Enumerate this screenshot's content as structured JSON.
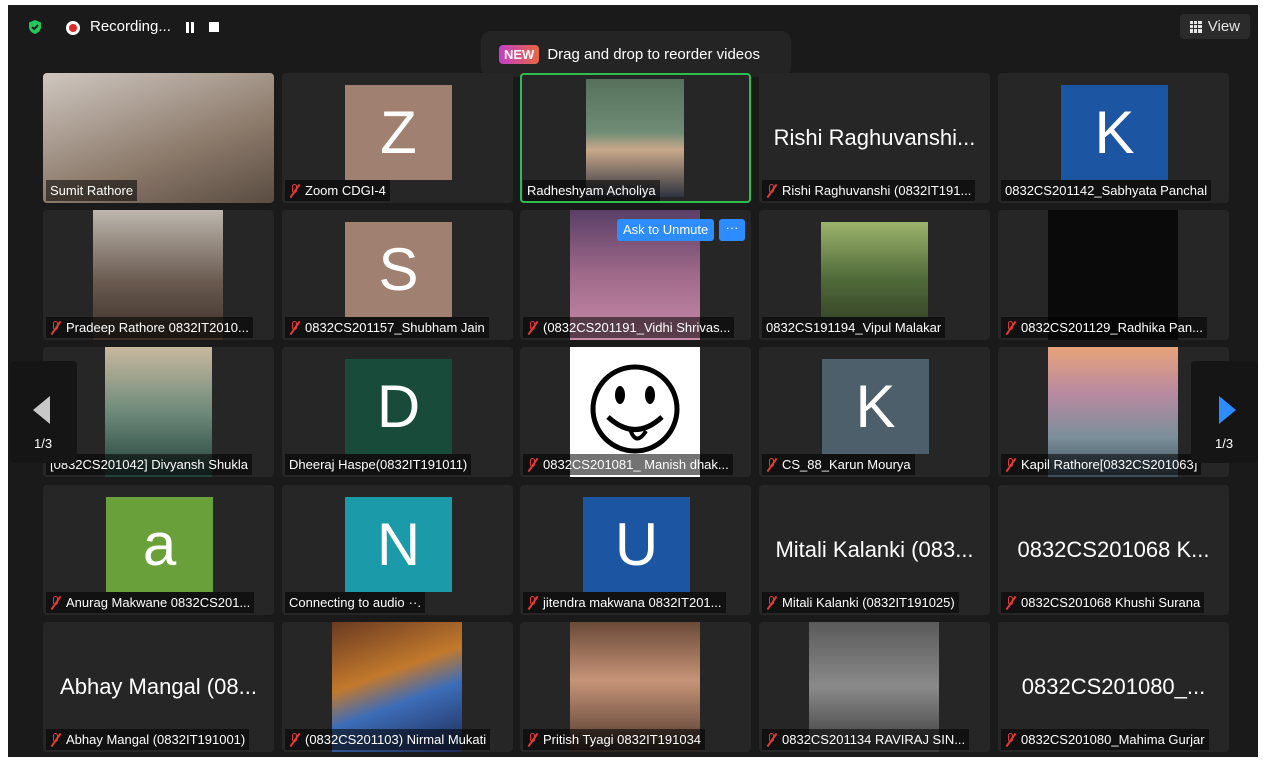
{
  "top_bar": {
    "recording_label": "Recording...",
    "view_label": "View"
  },
  "banner": {
    "badge": "NEW",
    "text": "Drag and drop to reorder videos"
  },
  "pagination": {
    "left_label": "1/3",
    "right_label": "1/3"
  },
  "colors": {
    "active_speaker_border": "#2fbd4e",
    "accent_blue": "#2d8cff",
    "muted_red": "#e23b3b"
  },
  "tiles": [
    {
      "label": "Sumit Rathore",
      "muted": false,
      "kind": "video"
    },
    {
      "label": "Zoom CDGI-4",
      "muted": true,
      "kind": "avatar",
      "letter": "Z",
      "color": "#a08070"
    },
    {
      "label": "Radheshyam Acholiya",
      "muted": false,
      "kind": "video",
      "active": true
    },
    {
      "label": "Rishi Raghuvanshi (0832IT191...",
      "muted": true,
      "kind": "name",
      "big_name": "Rishi Raghuvanshi..."
    },
    {
      "label": "0832CS201142_Sabhyata Panchal",
      "muted": false,
      "kind": "avatar",
      "letter": "K",
      "color": "#1c55a2"
    },
    {
      "label": "Pradeep Rathore 0832IT2010...",
      "muted": true,
      "kind": "video"
    },
    {
      "label": "0832CS201157_Shubham Jain",
      "muted": true,
      "kind": "avatar",
      "letter": "S",
      "color": "#a08070"
    },
    {
      "label": "(0832CS201191_Vidhi Shrivas...",
      "muted": true,
      "kind": "video",
      "ask_to_unmute": "Ask to Unmute",
      "more": "···"
    },
    {
      "label": "0832CS191194_Vipul Malakar",
      "muted": false,
      "kind": "video"
    },
    {
      "label": "0832CS201129_Radhika Pan...",
      "muted": true,
      "kind": "video"
    },
    {
      "label": "[0832CS201042] Divyansh Shukla",
      "muted": false,
      "kind": "video"
    },
    {
      "label": "Dheeraj Haspe(0832IT191011)",
      "muted": false,
      "kind": "avatar",
      "letter": "D",
      "color": "#184b3a"
    },
    {
      "label": "0832CS201081_ Manish dhak...",
      "muted": true,
      "kind": "video"
    },
    {
      "label": "CS_88_Karun Mourya",
      "muted": true,
      "kind": "avatar",
      "letter": "K",
      "color": "#4d5f6a"
    },
    {
      "label": "Kapil Rathore[0832CS201063]",
      "muted": true,
      "kind": "video"
    },
    {
      "label": "Anurag Makwane 0832CS201...",
      "muted": true,
      "kind": "avatar",
      "letter": "a",
      "color": "#6aa03a"
    },
    {
      "label": "Connecting to audio",
      "muted": false,
      "kind": "avatar",
      "letter": "N",
      "color": "#1b9aaa",
      "suffix": "··."
    },
    {
      "label": "jitendra makwana 0832IT201...",
      "muted": true,
      "kind": "avatar",
      "letter": "U",
      "color": "#1c55a2"
    },
    {
      "label": "Mitali Kalanki (0832IT191025)",
      "muted": true,
      "kind": "name",
      "big_name": "Mitali Kalanki (083..."
    },
    {
      "label": "0832CS201068 Khushi Surana",
      "muted": true,
      "kind": "name",
      "big_name": "0832CS201068 K..."
    },
    {
      "label": "Abhay Mangal (0832IT191001)",
      "muted": true,
      "kind": "name",
      "big_name": "Abhay Mangal (08..."
    },
    {
      "label": "(0832CS201103) Nirmal Mukati",
      "muted": true,
      "kind": "video"
    },
    {
      "label": "Pritish Tyagi 0832IT191034",
      "muted": true,
      "kind": "video"
    },
    {
      "label": "0832CS201134 RAVIRAJ SIN...",
      "muted": true,
      "kind": "video"
    },
    {
      "label": "0832CS201080_Mahima Gurjar",
      "muted": true,
      "kind": "name",
      "big_name": "0832CS201080_..."
    }
  ]
}
